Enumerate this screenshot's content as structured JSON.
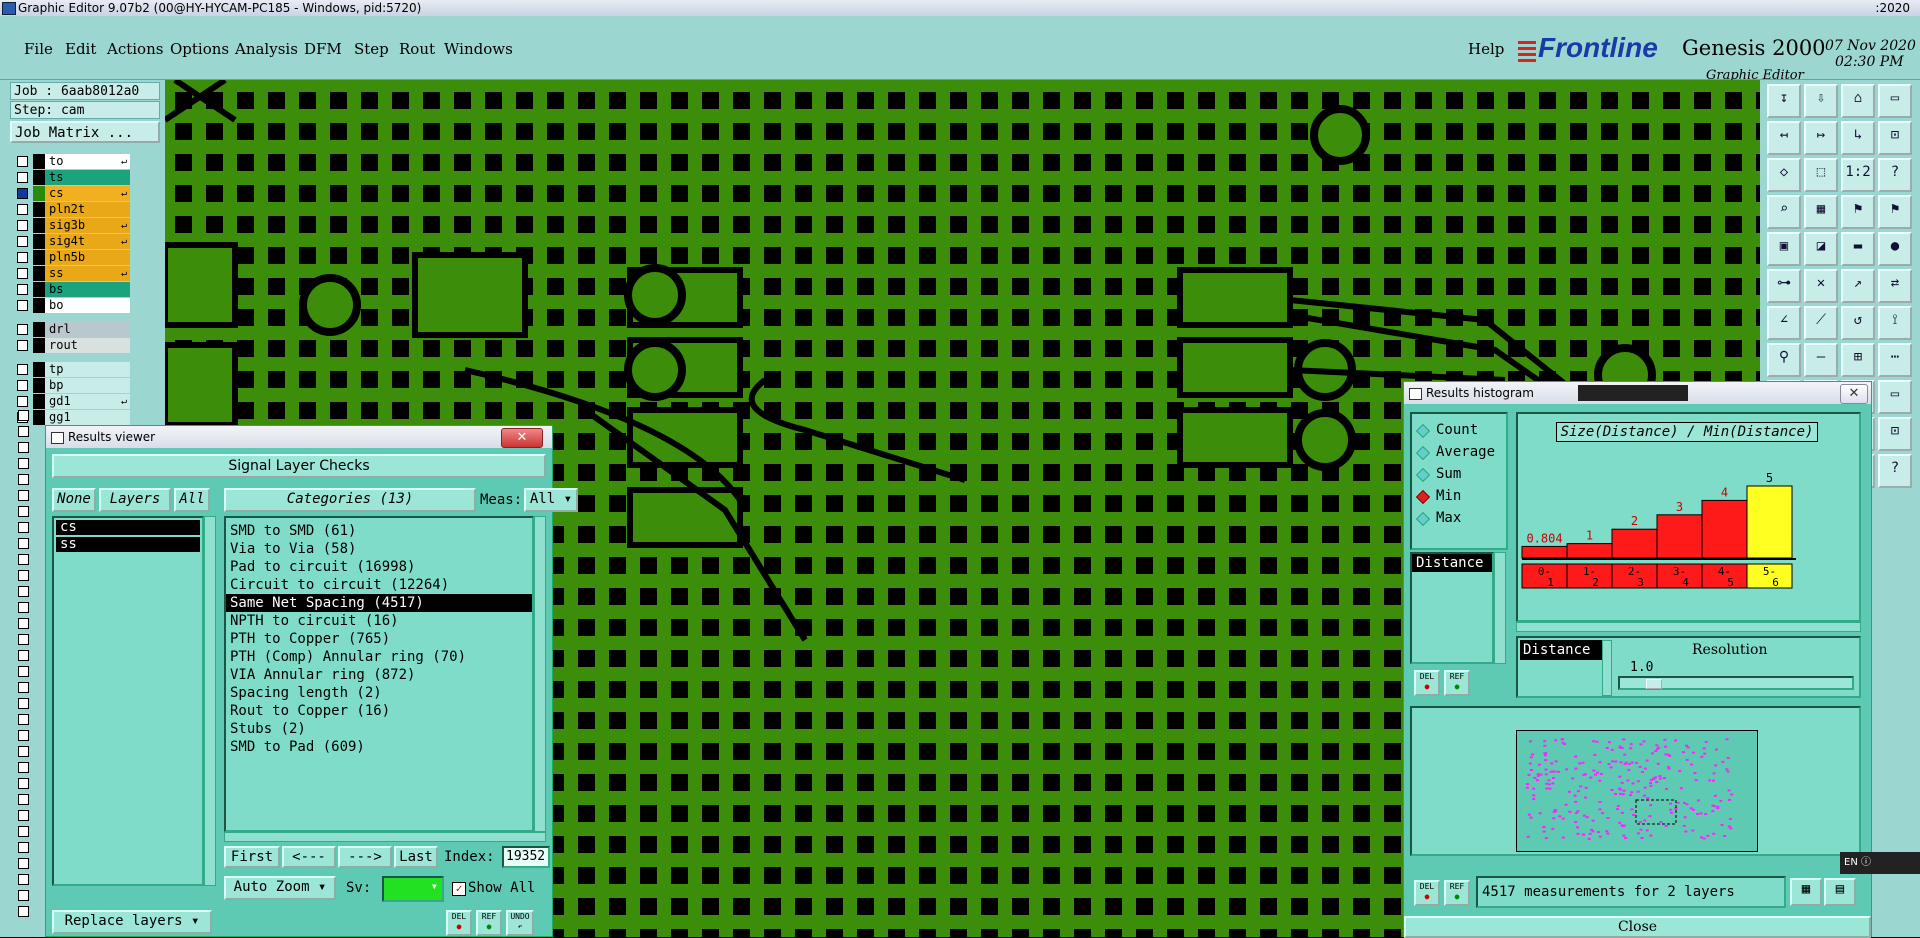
{
  "titlebar": {
    "title": "Graphic Editor 9.07b2 (00@HY-HYCAM-PC185 - Windows, pid:5720)",
    "clock": ":2020"
  },
  "menu": {
    "items": [
      "File",
      "Edit",
      "Actions",
      "Options",
      "Analysis",
      "DFM",
      "Step",
      "Rout",
      "Windows"
    ],
    "help": "Help"
  },
  "brand": {
    "logo": "Frontline",
    "product": "Genesis 2000",
    "subtitle": "Graphic Editor",
    "date": "07 Nov 2020",
    "time": "02:30 PM"
  },
  "job": {
    "job": "Job : 6aab8012a0",
    "step": "Step: cam",
    "matrix_btn": "Job Matrix ..."
  },
  "layers": [
    {
      "name": "to",
      "color": "#ffffff",
      "mark": true
    },
    {
      "name": "ts",
      "color": "#1aa37c",
      "mark": false
    },
    {
      "name": "cs",
      "color": "#f0b020",
      "mark": true,
      "active": true
    },
    {
      "name": "pln2t",
      "color": "#e8a818",
      "mark": false
    },
    {
      "name": "sig3b",
      "color": "#e8a818",
      "mark": true
    },
    {
      "name": "sig4t",
      "color": "#e8a818",
      "mark": true
    },
    {
      "name": "pln5b",
      "color": "#e8a818",
      "mark": false
    },
    {
      "name": "ss",
      "color": "#e8a818",
      "mark": true
    },
    {
      "name": "bs",
      "color": "#1aa37c",
      "mark": false
    },
    {
      "name": "bo",
      "color": "#ffffff",
      "mark": false
    },
    {
      "name": "drl",
      "color": "#b8c8cc",
      "mark": false
    },
    {
      "name": "rout",
      "color": "#d8e0e0",
      "mark": false
    },
    {
      "name": "tp",
      "color": "#c8ece8",
      "mark": false
    },
    {
      "name": "bp",
      "color": "#c8ece8",
      "mark": false
    },
    {
      "name": "gd1",
      "color": "#c8ece8",
      "mark": true
    },
    {
      "name": "gg1",
      "color": "#c8ece8",
      "mark": false
    }
  ],
  "results_viewer": {
    "title": "Results viewer",
    "header": "Signal Layer Checks",
    "none_btn": "None",
    "layers_btn": "Layers",
    "all_btn": "All",
    "layer_items": [
      "cs",
      "ss"
    ],
    "categories_btn": "Categories (13)",
    "meas_label": "Meas:",
    "meas_value": "All",
    "categories": [
      "SMD to SMD (61)",
      "Via to Via (58)",
      "Pad to circuit (16998)",
      "Circuit to circuit (12264)",
      "Same Net Spacing (4517)",
      "NPTH to circuit (16)",
      "PTH to Copper (765)",
      "PTH (Comp) Annular ring (70)",
      "VIA Annular ring (872)",
      "Spacing length (2)",
      "Rout to Copper (16)",
      "Stubs (2)",
      "SMD to Pad (609)"
    ],
    "selected_category": 4,
    "nav": {
      "first": "First",
      "prev": "<---",
      "next": "--->",
      "last": "Last",
      "index_label": "Index:",
      "index_value": "19352"
    },
    "auto_zoom": "Auto Zoom",
    "sv_label": "Sv:",
    "show_all": "Show All",
    "replace_layers": "Replace layers",
    "del": "DEL",
    "ref": "REF",
    "undo": "UNDO"
  },
  "histogram": {
    "title": "Results histogram",
    "options": [
      {
        "label": "Count",
        "on": false
      },
      {
        "label": "Average",
        "on": false
      },
      {
        "label": "Sum",
        "on": false
      },
      {
        "label": "Min",
        "on": true
      },
      {
        "label": "Max",
        "on": false
      }
    ],
    "list_item": "Distance",
    "chart_title": "Size(Distance) / Min(Distance)",
    "del": "DEL",
    "ref": "REF",
    "resolution_label": "Resolution",
    "resolution_field": "Distance",
    "resolution_value": "1.0",
    "status": "4517 measurements for 2 layers",
    "close": "Close",
    "lang": "EN"
  },
  "chart_data": {
    "type": "bar",
    "title": "Size(Distance) / Min(Distance)",
    "categories": [
      "0-1",
      "1-2",
      "2-3",
      "3-4",
      "4-5",
      "5-6"
    ],
    "values": [
      0.804,
      1,
      2,
      3,
      4,
      5
    ],
    "labels": [
      "0.804",
      "1",
      "2",
      "3",
      "4",
      "5"
    ],
    "colors": [
      "#ff1a1a",
      "#ff1a1a",
      "#ff1a1a",
      "#ff1a1a",
      "#ff1a1a",
      "#ffff22"
    ],
    "ylim": [
      0,
      5
    ]
  },
  "colors": {
    "copper": "#3c8e0a",
    "panel": "#9bd6d0",
    "window": "#5fcab4",
    "selected_bar": "#ffff22",
    "bar": "#ff1a1a"
  }
}
